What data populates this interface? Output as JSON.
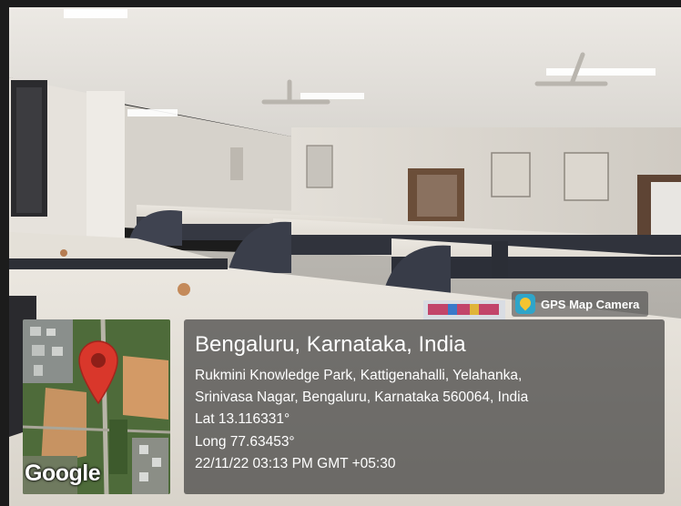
{
  "camera_badge": {
    "label": "GPS Map Camera",
    "icon": "gps-map-camera-icon"
  },
  "map": {
    "provider_mark": "Google",
    "icon": "map-pin-icon"
  },
  "location": {
    "city": "Bengaluru, Karnataka, India",
    "address_line_1": "Rukmini Knowledge Park, Kattigenahalli, Yelahanka,",
    "address_line_2": "Srinivasa Nagar, Bengaluru, Karnataka 560064, India",
    "latitude": "Lat 13.116331°",
    "longitude": "Long 77.63453°",
    "timestamp": "22/11/22 03:13 PM GMT +05:30"
  },
  "colors": {
    "pin": "#d9372b",
    "overlay": "#282828"
  }
}
